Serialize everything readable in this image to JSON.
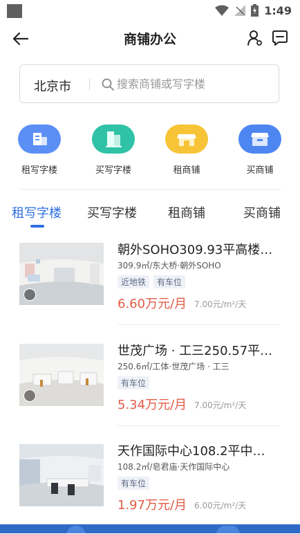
{
  "status": {
    "time": "1:49"
  },
  "appbar": {
    "title": "商铺办公"
  },
  "search": {
    "city": "北京市",
    "placeholder": "搜索商铺或写字楼"
  },
  "categories": [
    {
      "label": "租写字楼",
      "color": "#5b8ff5"
    },
    {
      "label": "买写字楼",
      "color": "#2fc2a6"
    },
    {
      "label": "租商铺",
      "color": "#f7c437"
    },
    {
      "label": "买商铺",
      "color": "#4d86f0"
    }
  ],
  "tabs": [
    {
      "label": "租写字楼",
      "active": true
    },
    {
      "label": "买写字楼",
      "active": false
    },
    {
      "label": "租商铺",
      "active": false
    },
    {
      "label": "买商铺",
      "active": false
    }
  ],
  "listings": [
    {
      "title": "朝外SOHO309.93平高楼…",
      "subtitle": "309.9㎡/东大桥·朝外SOHO",
      "tags": [
        "近地铁",
        "有车位"
      ],
      "price": "6.60万元/月",
      "unit_price": "7.00元/m²/天"
    },
    {
      "title": "世茂广场 · 工三250.57平…",
      "subtitle": "250.6㎡/工体·世茂广场 · 工三",
      "tags": [
        "有车位"
      ],
      "price": "5.34万元/月",
      "unit_price": "7.00元/m²/天"
    },
    {
      "title": "天作国际中心108.2平中楼…",
      "subtitle": "108.2㎡/皂君庙·天作国际中心",
      "tags": [
        "有车位"
      ],
      "price": "1.97万元/月",
      "unit_price": "6.00元/m²/天"
    }
  ],
  "colors": {
    "accent": "#2d6fe0",
    "price": "#e25b45"
  },
  "icons": [
    "back-arrow-icon",
    "user-settings-icon",
    "message-icon",
    "search-icon",
    "wifi-icon",
    "signal-icon",
    "battery-icon",
    "vr-icon"
  ]
}
